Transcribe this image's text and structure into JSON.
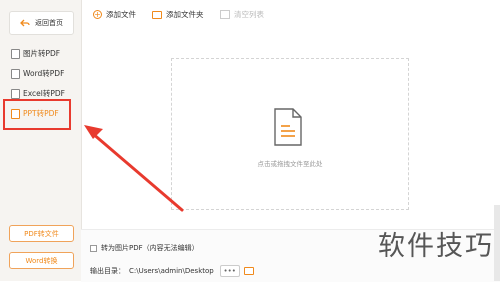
{
  "sidebar": {
    "back_label": "返回首页",
    "items": [
      {
        "label": "图片转PDF"
      },
      {
        "label": "Word转PDF"
      },
      {
        "label": "Excel转PDF"
      },
      {
        "label": "PPT转PDF"
      }
    ],
    "pdf_to_file_label": "PDF转文件",
    "word_convert_label": "Word转换"
  },
  "toolbar": {
    "add_file_label": "添加文件",
    "add_folder_label": "添加文件夹",
    "clear_list_label": "清空列表"
  },
  "dropzone": {
    "hint": "点击或拖拽文件至此处"
  },
  "bottom": {
    "convert_to_image_label": "转为图片PDF（内容无法编辑）",
    "output_dir_label": "输出目录：",
    "output_path": "C:\\Users\\admin\\Desktop",
    "more_label": "•••"
  },
  "watermark": "软件技巧",
  "colors": {
    "accent": "#f08a1c",
    "annotation_red": "#e83a2e"
  }
}
